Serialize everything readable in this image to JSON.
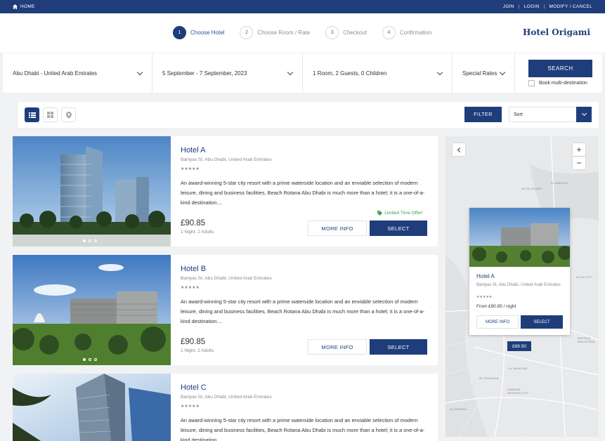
{
  "topbar": {
    "home": "HOME",
    "join": "JOIN",
    "login": "LOGIN",
    "modify": "MODIFY / CANCEL"
  },
  "steps": [
    {
      "num": "1",
      "label": "Choose Hotel"
    },
    {
      "num": "2",
      "label": "Choose Room / Rate"
    },
    {
      "num": "3",
      "label": "Checkout"
    },
    {
      "num": "4",
      "label": "Confirmation"
    }
  ],
  "brand": "Hotel Origami",
  "search": {
    "destination": "Abu Dhabi - United Arab Emirates",
    "dates": "5 September - 7 September, 2023",
    "guests": "1 Room, 2 Guests, 0 Children",
    "rates": "Special Rates",
    "button": "SEARCH",
    "multi": "Book multi-destination"
  },
  "toolbar": {
    "filter": "FILTER",
    "sort": "Sort"
  },
  "hotels": [
    {
      "name": "Hotel A",
      "address": "Baniyas St, Abu Dhabi, United Arab Emirates",
      "rating": 5,
      "description": "An award-winning 5-star city resort with a prime waterside location and an enviable selection of modern leisure, dining and business facilities, Beach Rotana Abu Dhabi is much more than a hotel; it is a one-of-a-kind destination....",
      "offer": "Limited Time Offer!",
      "price": "£90.85",
      "nights": "1 Night, 2 Adults",
      "more": "MORE INFO",
      "select": "SELECT"
    },
    {
      "name": "Hotel B",
      "address": "Baniyas St, Abu Dhabi, United Arab Emirates",
      "rating": 5,
      "description": "An award-winning 5-star city resort with a prime waterside location and an enviable selection of modern leisure, dining and business facilities, Beach Rotana Abu Dhabi is much more than a hotel; it is a one-of-a-kind destination....",
      "price": "£90.85",
      "nights": "1 Night, 2 Adults",
      "more": "MORE INFO",
      "select": "SELECT"
    },
    {
      "name": "Hotel C",
      "address": "Baniyas St, Abu Dhabi, United Arab Emirates",
      "rating": 5,
      "description": "An award-winning 5-star city resort with a prime waterside location and an enviable selection of modern leisure, dining and business facilities, Beach Rotana Abu Dhabi is much more than a hotel; it is a one-of-a-kind destination...."
    }
  ],
  "map": {
    "popup": {
      "name": "Hotel A",
      "address": "Baniyas St, Abu Dhabi, United Arab Emirates",
      "from": "From £90.85 / night",
      "more": "MORE INFO",
      "select": "SELECT"
    },
    "price_tag": "£89.50",
    "labels": [
      "ALIYA ISLAND",
      "AL BAHYAH",
      "AL BAHIAH",
      "AL RAHBA",
      "SAADIYAT ISLAND",
      "ALIYA CITY",
      "MAFRAQ INDUSTRIAL",
      "AL SHAMKHA",
      "AL BAHDION",
      "AL SHAMKHA",
      "HAMDAN WORKER CITY",
      "AL DHAFRA"
    ]
  },
  "colors": {
    "brand": "#1f3d7a",
    "offer": "#3aa14a",
    "background": "#f1f2f4"
  }
}
